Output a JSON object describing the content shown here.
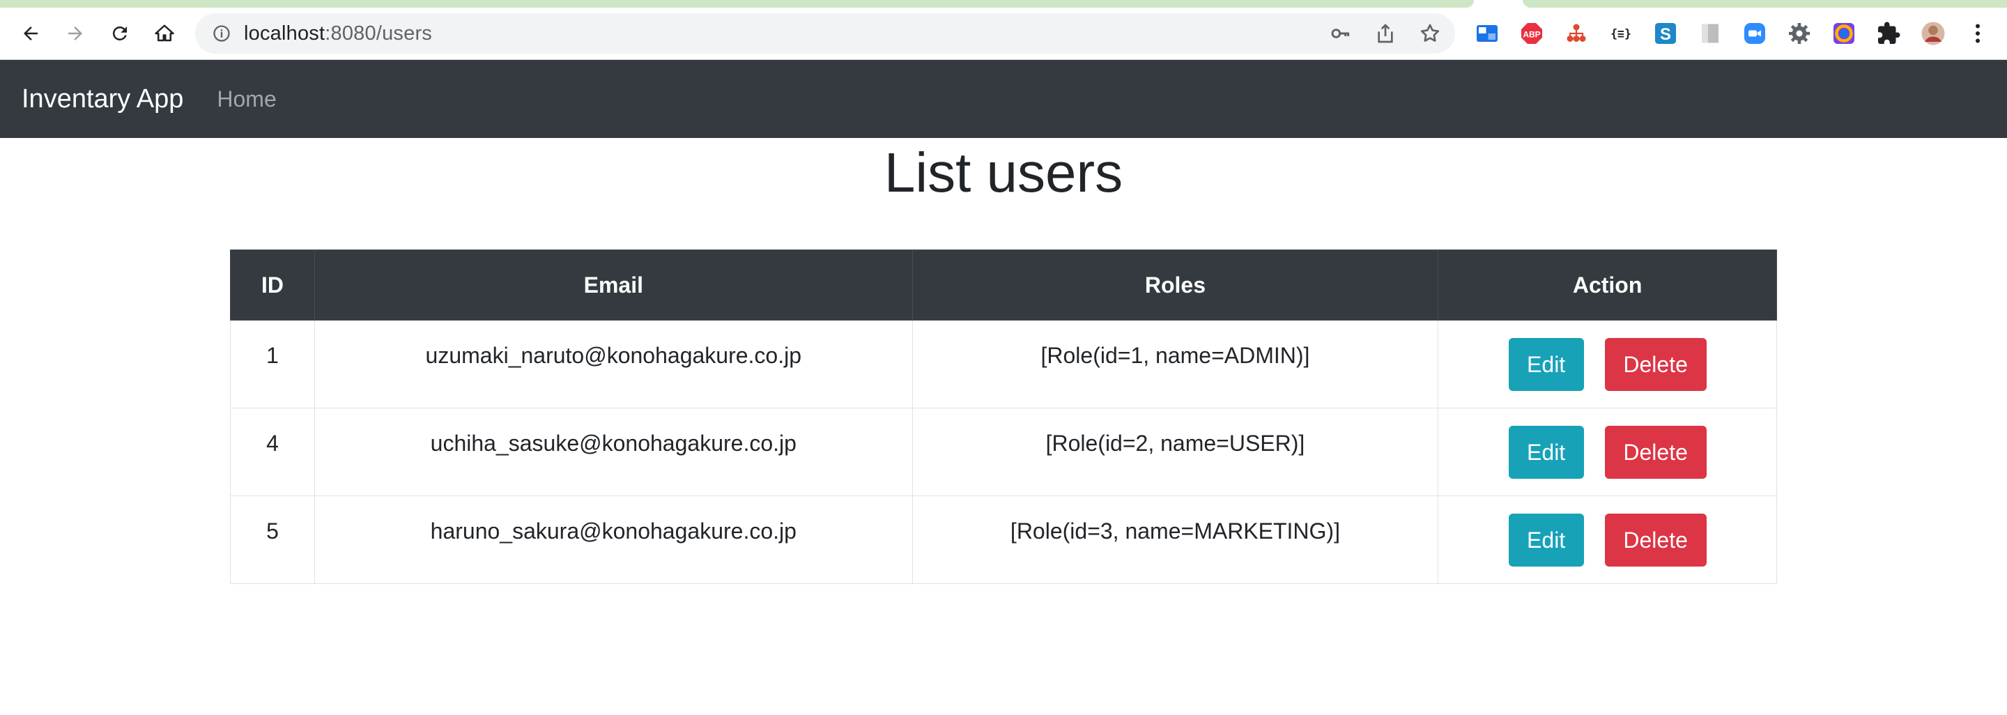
{
  "browser": {
    "url_host": "localhost",
    "url_path": ":8080/users",
    "extensions": [
      {
        "name": "extension-reading-icon",
        "color": "#1a73e8"
      },
      {
        "name": "adblock-plus-icon",
        "label": "ABP",
        "color": "#e8303e"
      },
      {
        "name": "extension-tree-icon",
        "color": "#e0492e"
      },
      {
        "name": "json-formatter-icon",
        "label": "{≡}",
        "color": "#202124"
      },
      {
        "name": "extension-s-icon",
        "label": "S",
        "color": "#1e88c8"
      },
      {
        "name": "extension-bookmark-icon",
        "color": "#bdbdbd"
      },
      {
        "name": "zoom-icon",
        "color": "#2d8cff"
      },
      {
        "name": "settings-gear-icon",
        "color": "#5f6368"
      },
      {
        "name": "color-picker-icon",
        "color": "#7b3fe4"
      },
      {
        "name": "extensions-puzzle-icon",
        "color": "#202124"
      },
      {
        "name": "profile-avatar",
        "color": "#b07a5a"
      }
    ]
  },
  "navbar": {
    "brand": "Inventary App",
    "links": [
      "Home"
    ],
    "bg_color": "#343a40"
  },
  "main": {
    "title": "List users",
    "table": {
      "headers": [
        "ID",
        "Email",
        "Roles",
        "Action"
      ],
      "rows": [
        {
          "id": "1",
          "email": "uzumaki_naruto@konohagakure.co.jp",
          "roles": "[Role(id=1, name=ADMIN)]"
        },
        {
          "id": "4",
          "email": "uchiha_sasuke@konohagakure.co.jp",
          "roles": "[Role(id=2, name=USER)]"
        },
        {
          "id": "5",
          "email": "haruno_sakura@konohagakure.co.jp",
          "roles": "[Role(id=3, name=MARKETING)]"
        }
      ],
      "edit_label": "Edit",
      "delete_label": "Delete"
    },
    "colors": {
      "edit": "#17a2b8",
      "delete": "#dc3545"
    }
  }
}
